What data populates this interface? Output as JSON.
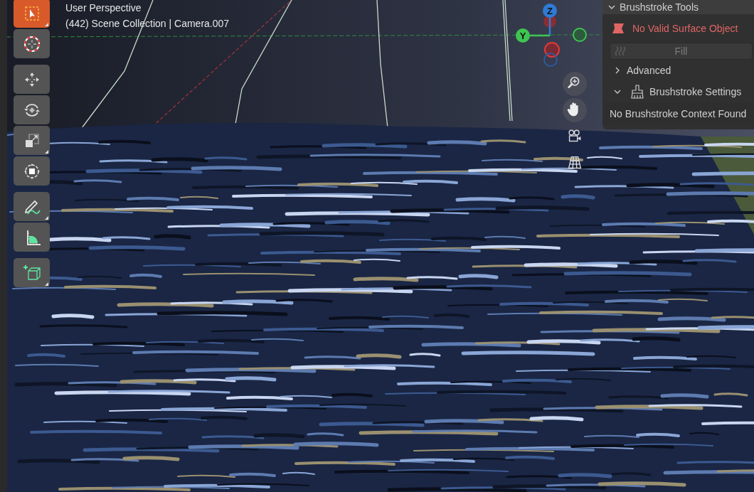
{
  "viewport": {
    "view_name": "User Perspective",
    "collection_info": "(442) Scene Collection | Camera.007"
  },
  "toolbar": {
    "groups": [
      [
        {
          "kind": "select_box",
          "selected": true
        },
        {
          "kind": "cursor",
          "selected": false
        }
      ],
      [
        {
          "kind": "move",
          "selected": false
        },
        {
          "kind": "rotate",
          "selected": false
        },
        {
          "kind": "scale",
          "selected": false
        },
        {
          "kind": "transform",
          "selected": false
        }
      ],
      [
        {
          "kind": "annotate",
          "selected": false
        },
        {
          "kind": "measure",
          "selected": false
        }
      ],
      [
        {
          "kind": "add_cube",
          "selected": false
        }
      ]
    ]
  },
  "gizmo": {
    "axes": [
      {
        "kind": "z",
        "label": "Z"
      },
      {
        "kind": "y",
        "label": "Y"
      }
    ]
  },
  "panel": {
    "title": "Brushstroke Tools",
    "expanded": true,
    "warning": "No Valid Surface Object",
    "fill_button": {
      "label": "Fill",
      "disabled": true
    },
    "sections": [
      {
        "label": "Advanced",
        "expanded": false,
        "kind": "plain"
      },
      {
        "label": "Brushstroke Settings",
        "expanded": true,
        "kind": "brush"
      }
    ],
    "message": "No Brushstroke Context Found"
  }
}
